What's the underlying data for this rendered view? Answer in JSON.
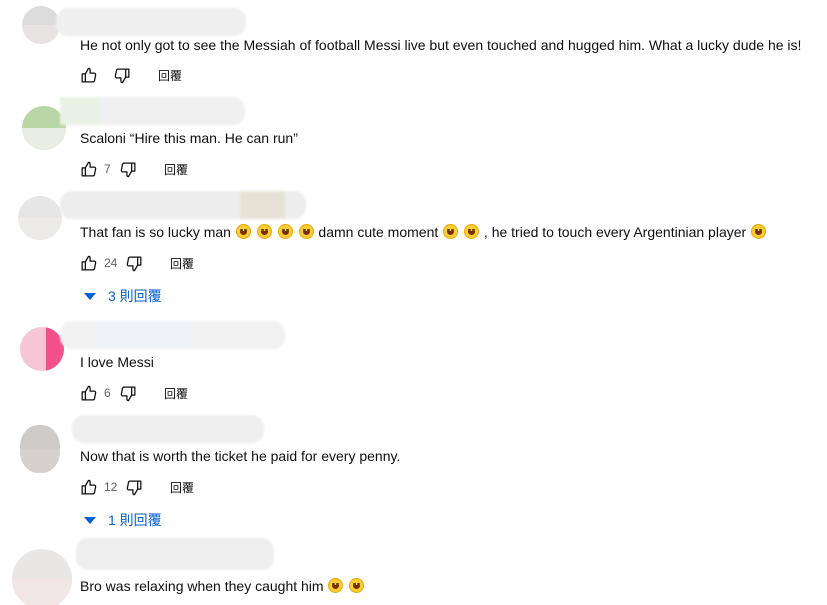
{
  "colors": {
    "link": "#065fd4",
    "text": "#0f0f0f",
    "muted": "#606060"
  },
  "reply_label": "回覆",
  "comments": [
    {
      "text": "He not only got to see the Messiah of football Messi live but even touched and hugged him. What a lucky dude he is!",
      "likes": ""
    },
    {
      "text": "Scaloni “Hire this man. He can run”",
      "likes": "7"
    },
    {
      "text_before": "That fan is so lucky man",
      "text_middle": "damn cute moment",
      "text_after": ", he tried to touch every Argentinian player",
      "likes": "24",
      "replies": "3 則回覆"
    },
    {
      "text": "I love Messi",
      "likes": "6"
    },
    {
      "text": "Now that is worth the ticket he paid for every penny.",
      "likes": "12",
      "replies": "1 則回覆"
    },
    {
      "text": "Bro was relaxing when they caught him",
      "likes": ""
    }
  ],
  "icons": {
    "like": "thumbs-up-icon",
    "dislike": "thumbs-down-icon",
    "expand": "caret-down-icon",
    "emoji_laugh": "rofl-emoji-icon",
    "emoji_joy": "joy-emoji-icon"
  }
}
